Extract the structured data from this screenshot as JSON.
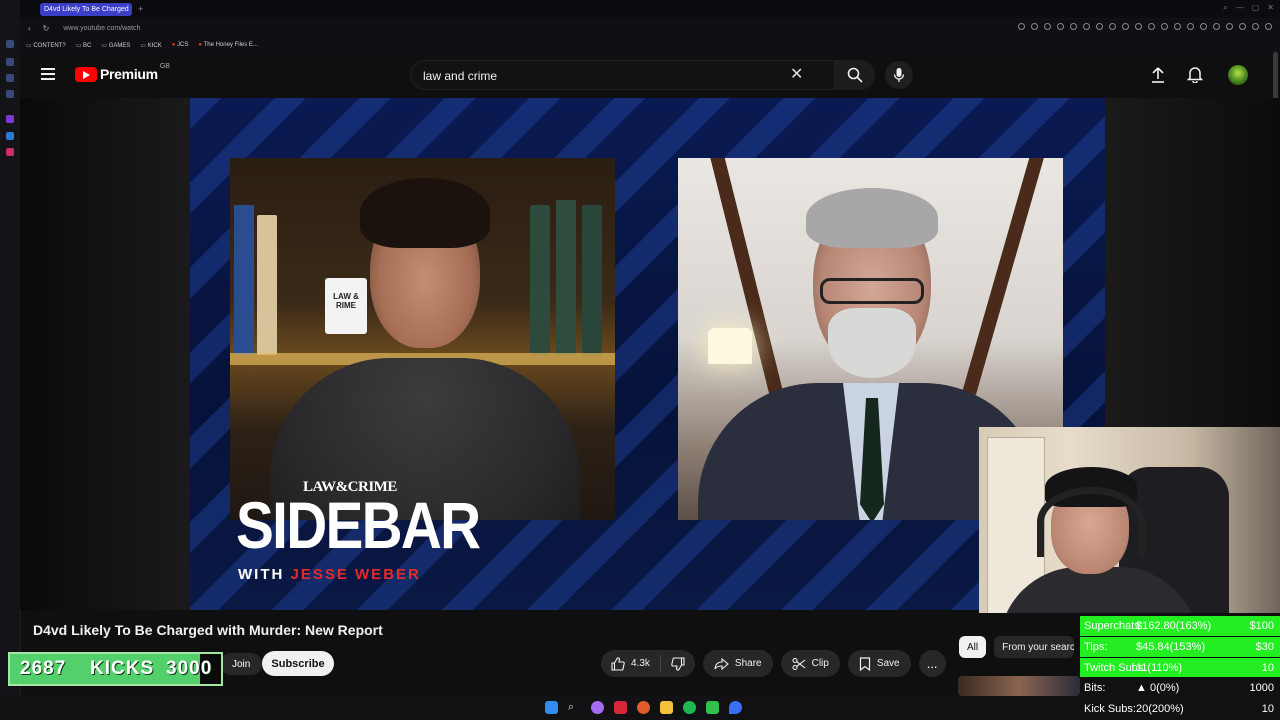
{
  "browser": {
    "tab_title": "D4vd Likely To Be Charged",
    "url": "www.youtube.com/watch",
    "bookmarks": [
      "CONTENT?",
      "BC",
      "GAMES",
      "KICK",
      "JCS",
      "The Honey Files E..."
    ]
  },
  "header": {
    "logo_word": "Premium",
    "logo_region": "GB",
    "search_value": "law and crime",
    "icons": [
      "menu-icon",
      "search-icon",
      "clear-icon",
      "mic-icon",
      "upload-icon",
      "bell-icon"
    ]
  },
  "video": {
    "title": "D4vd Likely To Be Charged with Murder: New Report",
    "overlay": {
      "brand_sub": "LAW&CRIME",
      "brand_title": "SIDEBAR",
      "with_label": "WITH ",
      "host": "JESSE WEBER"
    },
    "mug_text": "LAW & RIME"
  },
  "channel": {
    "join_label": "Join",
    "subscribe_label": "Subscribe"
  },
  "actions": {
    "likes": "4.3k",
    "share_label": "Share",
    "clip_label": "Clip",
    "save_label": "Save",
    "more_label": "..."
  },
  "chips": {
    "all_label": "All",
    "from_search_label": "From your search"
  },
  "kicks_goal": {
    "current": "2687",
    "label": "KICKS",
    "goal": "3000",
    "progress_fraction": 0.9
  },
  "goals_table": [
    {
      "name": "Superchats:",
      "progress": "$162.80(163%)",
      "target": "$100",
      "fraction": 1.0
    },
    {
      "name": "Tips:",
      "progress": "$45.84(153%)",
      "target": "$30",
      "fraction": 1.0
    },
    {
      "name": "Twitch Subs:",
      "progress": "11(110%)",
      "target": "10",
      "fraction": 1.0
    },
    {
      "name": "Bits:",
      "progress": "0(0%)",
      "target": "1000",
      "fraction": 0.0
    },
    {
      "name": "Kick Subs:",
      "progress": "20(200%)",
      "target": "10",
      "fraction": 1.0
    }
  ],
  "colors": {
    "youtube_red": "#ff0000",
    "goal_green": "#22ee22",
    "sidebar_red": "#e52a2a",
    "tab_blue": "#3b3fc7"
  }
}
